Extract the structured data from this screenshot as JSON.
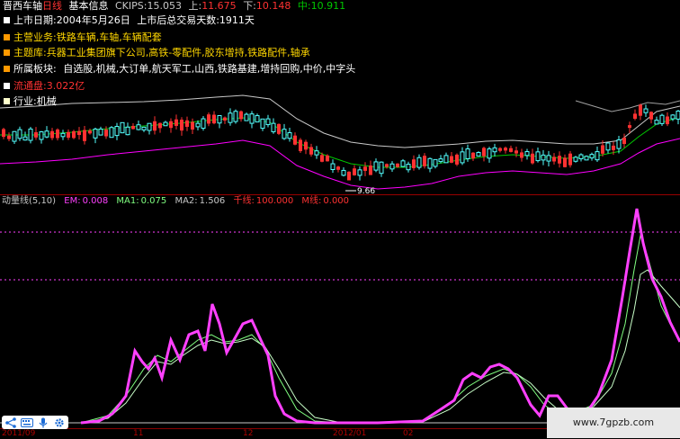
{
  "header": {
    "stock_name": "晋西车轴",
    "period": "日线",
    "tab_basic_info": "基本信息",
    "ckips_label": "CKIPS:",
    "ckips_value": "15.053",
    "up_label": "上:",
    "up_value": "11.675",
    "down_label": "下:",
    "down_value": "10.148",
    "mid_label": "中:",
    "mid_value": "10.911"
  },
  "info_panel": {
    "listing_date": "上市日期:2004年5月26日",
    "trading_days": "上市后总交易天数:1911天",
    "main_business": "主营业务:铁路车辆,车轴,车辆配套",
    "theme_library": "主题库:兵器工业集团旗下公司,高铁-零配件,胶东增持,铁路配件,轴承",
    "sector": "所属板块:",
    "sector_values": "自选股,机械,大订单,航天军工,山西,铁路基建,增持回购,中价,中字头",
    "float_cap": "流通盘:3.022亿",
    "industry": "行业:机械"
  },
  "price_chart": {
    "low_marker": "9.66"
  },
  "indicator": {
    "name": "动量线(5,10)",
    "em_label": "EM:",
    "em_value": "0.008",
    "ma1_label": "MA1:",
    "ma1_value": "0.075",
    "ma2_label": "MA2:",
    "ma2_value": "1.506",
    "extra1": "千线:",
    "extra1_value": "100.000",
    "extra2": "M线:",
    "extra2_value": "0.000"
  },
  "date_axis": {
    "labels": [
      "2011/09",
      "11",
      "12",
      "2012/01",
      "02"
    ]
  },
  "watermark": {
    "text": "www.7gpzb.com"
  },
  "colors": {
    "up_candle": "#ff3232",
    "down_candle": "#54ffff",
    "band_upper": "#c0c0c0",
    "band_mid": "#00c800",
    "band_lower": "#ff00ff",
    "magenta_line": "#ff40ff",
    "green_line": "#80ff80"
  },
  "toolbar": {
    "icons": [
      "share-icon",
      "keyboard-icon",
      "microphone-icon",
      "settings-icon"
    ]
  }
}
